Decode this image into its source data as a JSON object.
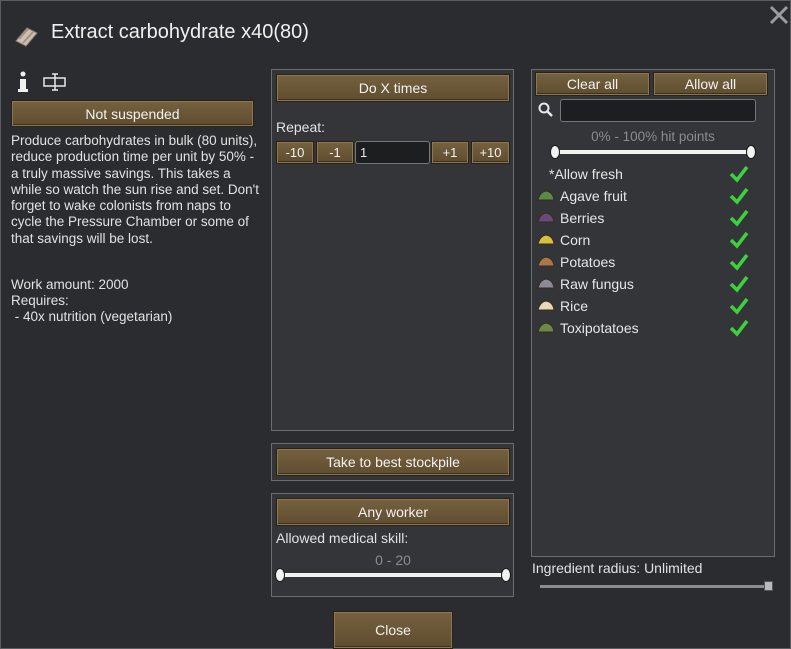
{
  "window": {
    "title": "Extract carbohydrate x40(80)",
    "close_glyph": "✕"
  },
  "left": {
    "info_glyph": "i",
    "suspend_button": "Not suspended",
    "description": "Produce carbohydrates in bulk (80 units), reduce production time per unit by 50% - a truly massive savings. This takes a while so watch the sun rise and set. Don't forget to wake colonists from naps to cycle the Pressure Chamber or some of that savings will be lost.",
    "work_amount": "Work amount: 2000",
    "requires_label": "Requires:",
    "requires_item": " - 40x nutrition (vegetarian)"
  },
  "middle": {
    "repeat_mode_button": "Do X times",
    "repeat_label": "Repeat:",
    "buttons": {
      "minus10": "-10",
      "minus1": "-1",
      "plus1": "+1",
      "plus10": "+10"
    },
    "repeat_value": "1",
    "store_button": "Take to best stockpile",
    "worker_button": "Any worker",
    "skill_label": "Allowed medical skill:",
    "skill_range_text": "0 - 20",
    "skill_range": {
      "min": 0,
      "max": 20,
      "low": 0,
      "high": 20
    }
  },
  "right": {
    "clear_all": "Clear all",
    "allow_all": "Allow all",
    "search_value": "",
    "hitpoints_text": "0% - 100% hit points",
    "hitpoints_range": {
      "low": 0,
      "high": 100
    },
    "allow_fresh": "*Allow fresh",
    "items": [
      {
        "label": "Agave fruit",
        "allowed": true,
        "color": "#5a8a4a"
      },
      {
        "label": "Berries",
        "allowed": true,
        "color": "#6a4a7a"
      },
      {
        "label": "Corn",
        "allowed": true,
        "color": "#d8c040"
      },
      {
        "label": "Potatoes",
        "allowed": true,
        "color": "#a8784a"
      },
      {
        "label": "Raw fungus",
        "allowed": true,
        "color": "#8a8a9a"
      },
      {
        "label": "Rice",
        "allowed": true,
        "color": "#e8d8b8"
      },
      {
        "label": "Toxipotatoes",
        "allowed": true,
        "color": "#6a8a4a"
      }
    ],
    "ingredient_radius": "Ingredient radius: Unlimited",
    "radius_fraction": 1.0
  },
  "footer": {
    "close_button": "Close"
  },
  "colors": {
    "check": "#3cd23c",
    "button": "#6b5636"
  }
}
